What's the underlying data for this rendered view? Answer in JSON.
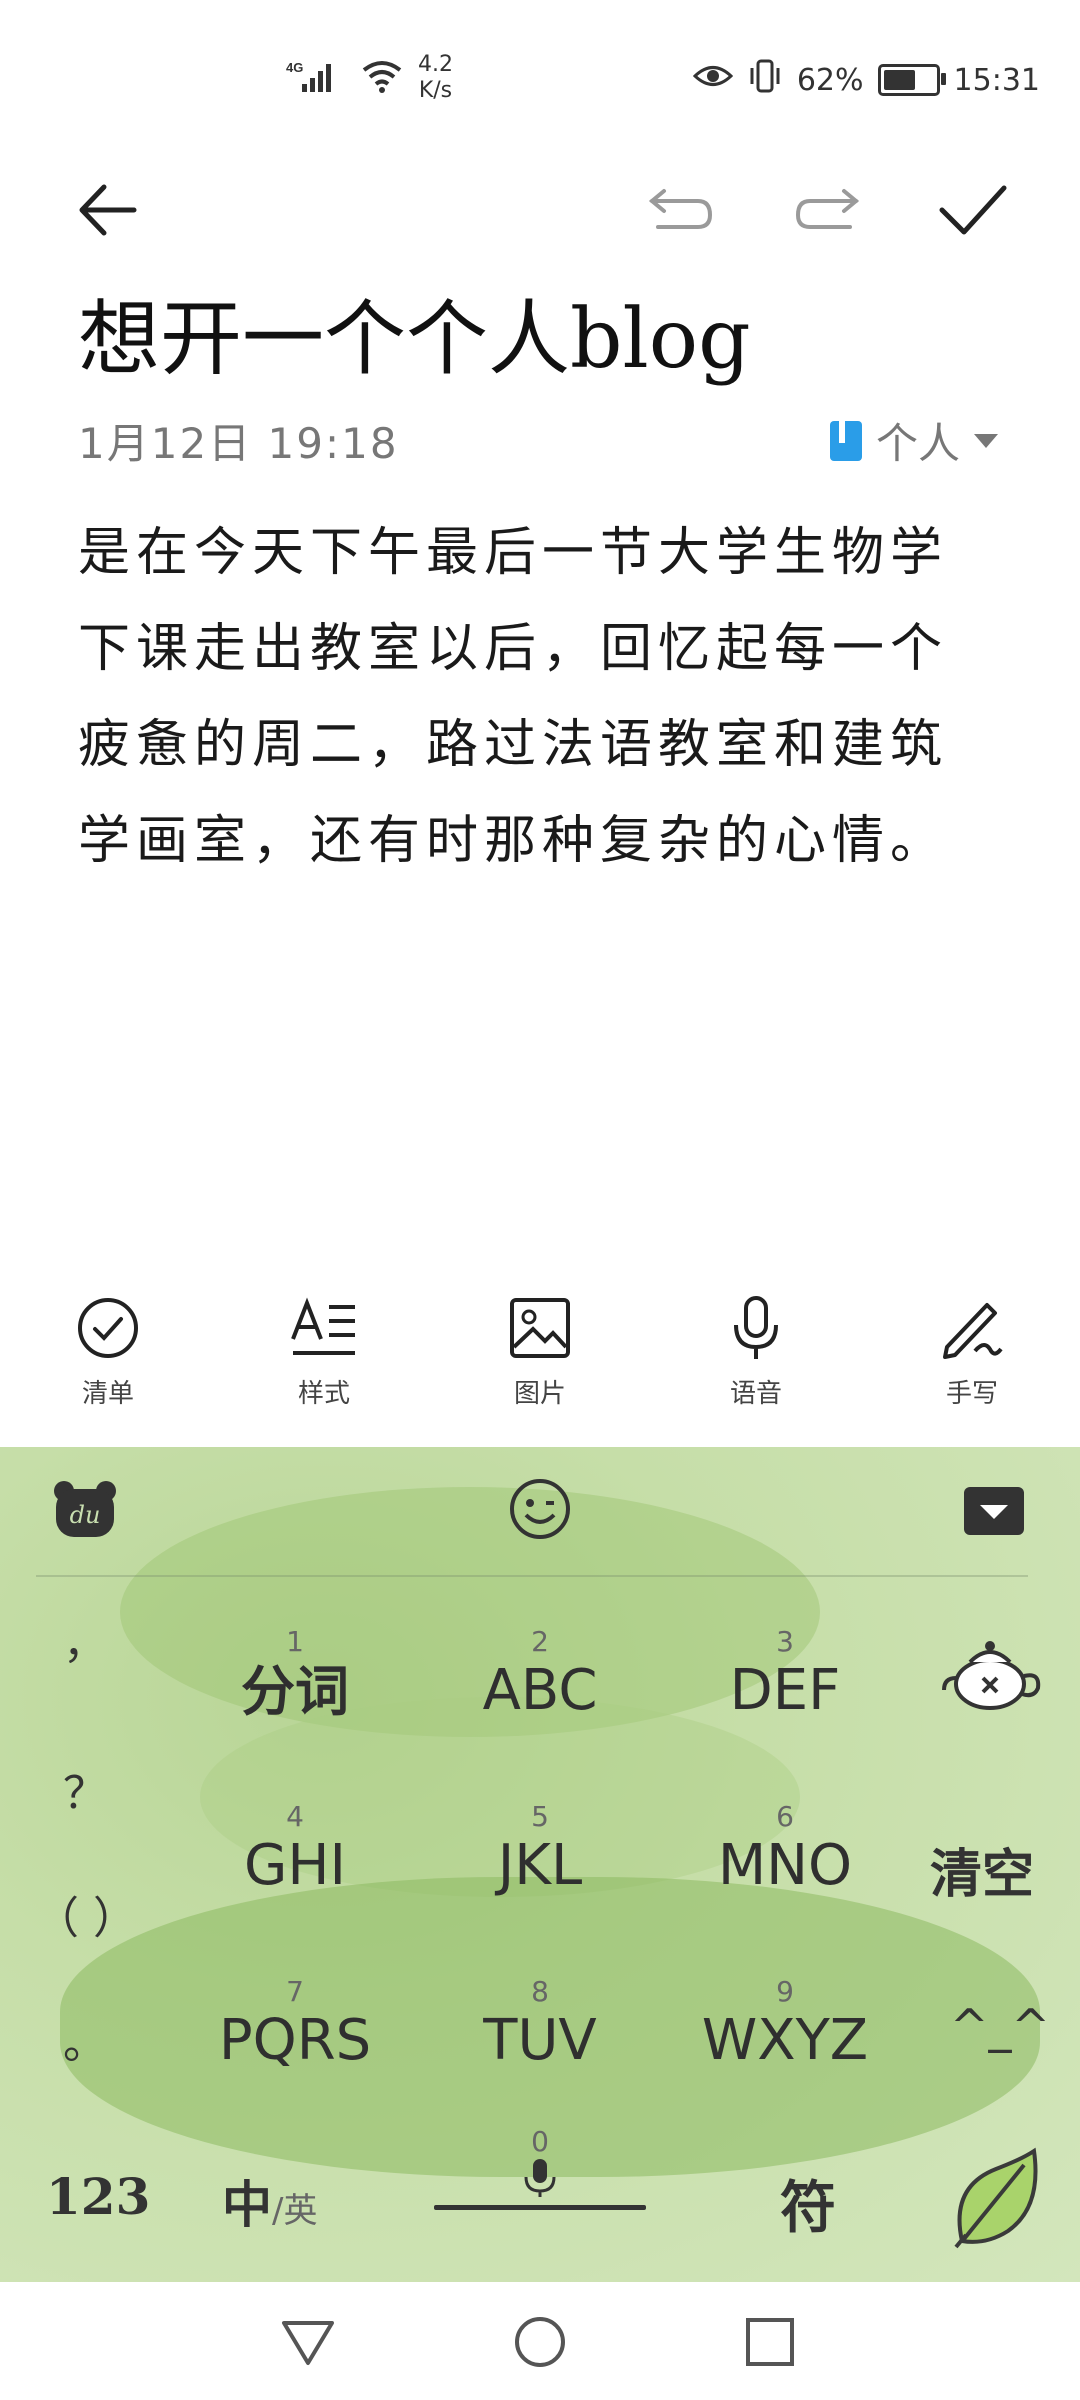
{
  "status_bar": {
    "network": "4G",
    "speed_value": "4.2",
    "speed_unit": "K/s",
    "battery_text": "62%",
    "battery_level": 0.62,
    "time": "15:31",
    "icons": [
      "signal-icon",
      "wifi-icon",
      "eye-icon",
      "vibrate-icon",
      "battery-icon"
    ]
  },
  "toolbar_top": {
    "icons": [
      "back-arrow-icon",
      "undo-icon",
      "redo-icon",
      "check-icon"
    ]
  },
  "note": {
    "title": "想开一个个人blog",
    "date": "1月12日 19:18",
    "folder": "个人",
    "body": "是在今天下午最后一节大学生物学下课走出教室以后，回忆起每一个疲惫的周二，路过法语教室和建筑学画室，还有时那种复杂的心情。"
  },
  "edit_toolbar": {
    "items": [
      {
        "label": "清单",
        "icon": "checklist-icon"
      },
      {
        "label": "样式",
        "icon": "text-style-icon"
      },
      {
        "label": "图片",
        "icon": "image-icon"
      },
      {
        "label": "语音",
        "icon": "microphone-icon"
      },
      {
        "label": "手写",
        "icon": "handwriting-icon"
      }
    ]
  },
  "keyboard": {
    "punctuation": [
      "，",
      "？",
      "（ ）",
      "。"
    ],
    "keys": [
      {
        "num": "1",
        "label": "分词"
      },
      {
        "num": "2",
        "label": "ABC"
      },
      {
        "num": "3",
        "label": "DEF"
      },
      {
        "num": "4",
        "label": "GHI"
      },
      {
        "num": "5",
        "label": "JKL"
      },
      {
        "num": "6",
        "label": "MNO"
      },
      {
        "num": "7",
        "label": "PQRS"
      },
      {
        "num": "8",
        "label": "TUV"
      },
      {
        "num": "9",
        "label": "WXYZ"
      }
    ],
    "clear_label": "清空",
    "face_label": "^_^",
    "num_label": "123",
    "lang_main": "中",
    "lang_alt": "/英",
    "space_num": "0",
    "symbol_label": "符",
    "colors": {
      "background": "#c9dfb0",
      "accent": "#8fbf5a"
    }
  },
  "nav": {
    "icons": [
      "back-triangle-icon",
      "home-circle-icon",
      "recents-square-icon"
    ]
  }
}
